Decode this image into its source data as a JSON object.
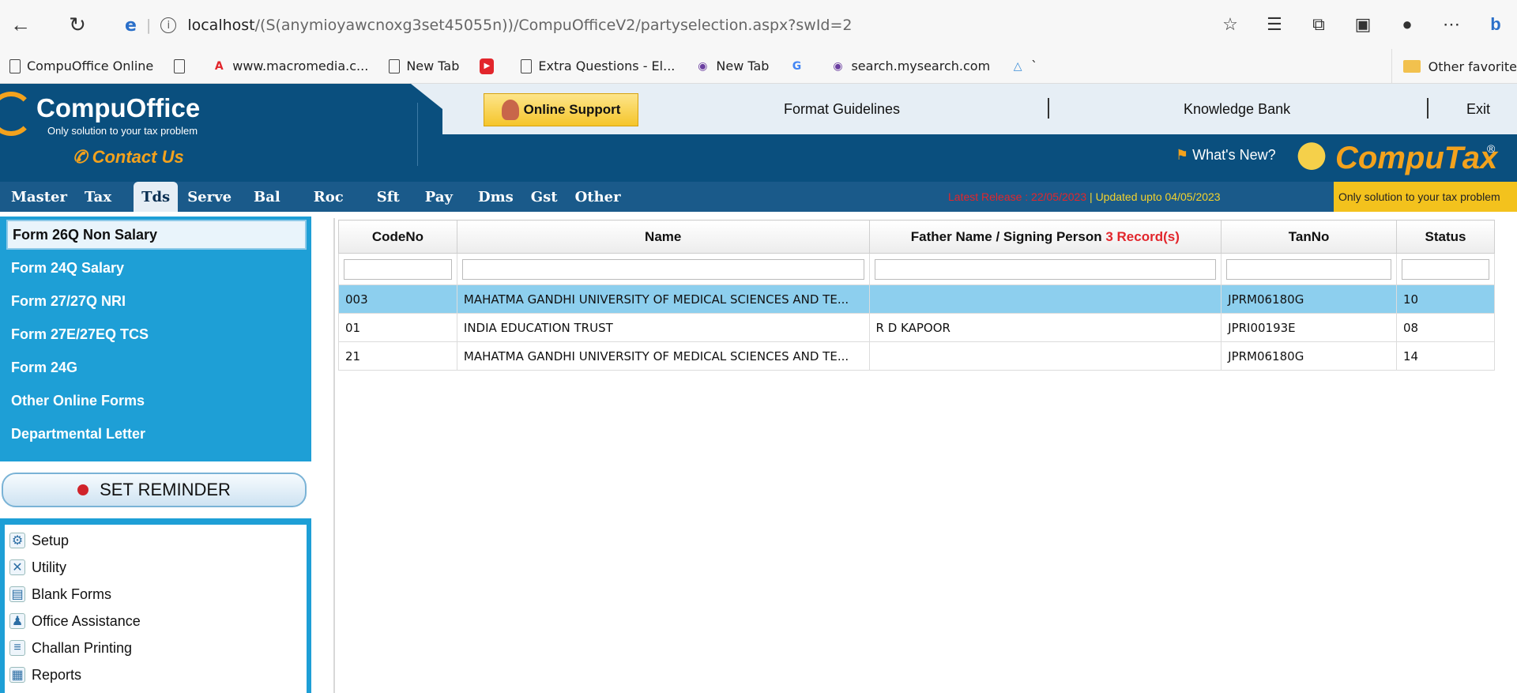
{
  "browser": {
    "url_host": "localhost",
    "url_path": "/(S(anymioyawcnoxg3set45055n))/CompuOfficeV2/partyselection.aspx?swId=2",
    "bookmarks": [
      "CompuOffice Online",
      "www.macromedia.c...",
      "New Tab",
      "Extra Questions - El...",
      "New Tab",
      "search.mysearch.com",
      "`"
    ],
    "other_favorites": "Other favorite"
  },
  "header": {
    "logo_title": "CompuOffice",
    "logo_tagline": "Only solution to your tax problem",
    "contact": "Contact Us",
    "online_support": "Online Support",
    "format_guidelines": "Format Guidelines",
    "knowledge_bank": "Knowledge Bank",
    "exit": "Exit",
    "whats_new": "What's New?",
    "computax": "CompuTax",
    "computax_reg": "®",
    "computax_tagline": "Only solution to your tax problem"
  },
  "menu": {
    "items": [
      "Master",
      "Tax",
      "Tds",
      "Serve",
      "Bal",
      "Roc",
      "Sft",
      "Pay",
      "Dms",
      "Gst",
      "Other"
    ],
    "active": "Tds",
    "release_label": "Latest Release : 22/05/2023",
    "release_sep": " | ",
    "updated": "Updated upto 04/05/2023"
  },
  "left_menu": {
    "items": [
      "Form 26Q Non Salary",
      "Form 24Q Salary",
      "Form 27/27Q NRI",
      "Form 27E/27EQ TCS",
      "Form 24G",
      "Other Online Forms",
      "Departmental Letter"
    ],
    "selected": "Form 26Q Non Salary",
    "reminder": "SET REMINDER",
    "tools": [
      "Setup",
      "Utility",
      "Blank Forms",
      "Office Assistance",
      "Challan Printing",
      "Reports"
    ]
  },
  "grid": {
    "columns": [
      "CodeNo",
      "Name",
      "Father Name / Signing Person",
      "TanNo",
      "Status"
    ],
    "record_count": "3 Record(s)",
    "rows": [
      {
        "code": "003",
        "name": "MAHATMA GANDHI UNIVERSITY OF MEDICAL SCIENCES AND TE...",
        "father": "",
        "tan": "JPRM06180G",
        "status": "10"
      },
      {
        "code": "01",
        "name": "INDIA EDUCATION TRUST",
        "father": "R D KAPOOR",
        "tan": "JPRI00193E",
        "status": "08"
      },
      {
        "code": "21",
        "name": "MAHATMA GANDHI UNIVERSITY OF MEDICAL SCIENCES AND TE...",
        "father": "",
        "tan": "JPRM06180G",
        "status": "14"
      }
    ]
  }
}
